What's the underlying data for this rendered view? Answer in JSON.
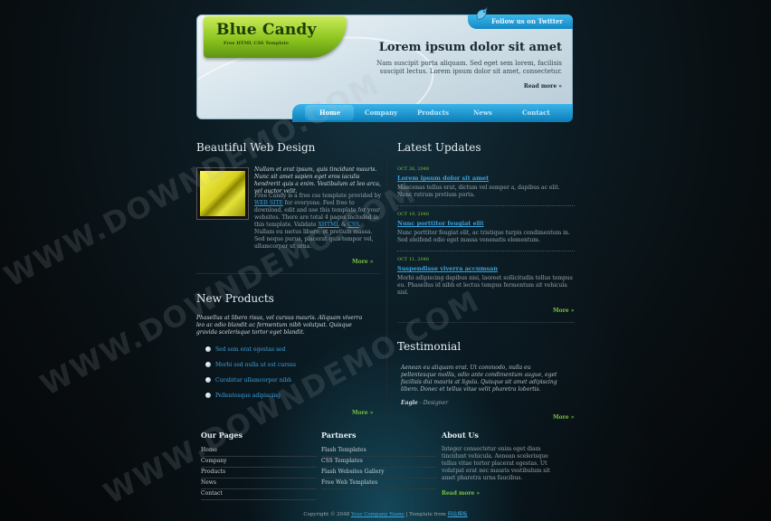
{
  "header": {
    "logo_title": "Blue Candy",
    "logo_subtitle": "Free HTML CSS Template",
    "twitter_label": "Follow us on Twitter",
    "hero_title": "Lorem ipsum dolor sit amet",
    "hero_text": "Nam suscipit porta aliquam. Sed eget sem lorem, facilisis suscipit lectus. Lorem ipsum dolor sit amet, consectetur.",
    "read_more": "Read more »"
  },
  "nav": {
    "items": [
      "Home",
      "Company",
      "Products",
      "News",
      "Contact"
    ],
    "active": "Home"
  },
  "left": {
    "title": "Beautiful Web Design",
    "intro_italic": "Nullam et erat ipsum, quis tincidunt mauris. Nunc sit amet sapien eget eros iaculis hendrerit quis a enim. Vestibulum at leo arcu, vel auctor velit.",
    "intro_text_a": "Free Candy is a free css template provided by ",
    "intro_link_a": "WEB SITE",
    "intro_text_b": " for everyone. Feel free to download, edit and use this template for your websites. There are total 4 pages included in this template. Validate ",
    "intro_link_b": "XHTML",
    "intro_text_c": " & ",
    "intro_link_c": "CSS",
    "intro_text_d": ". Nullam eu metus libero, et pretium massa. Sed neque purus, placerat quis tempor vel, ullamcorper ut urna.",
    "more1": "More »",
    "products_title": "New Products",
    "products_italic": "Phasellus at libero risus, vel cursus mauris. Aliquam viverra leo ac odio blandit ac fermentum nibh volutpat. Quisque gravida scelerisque tortor eget blandit.",
    "products": [
      "Sed sem erat egestas sed",
      "Morbi sed nulla ut est cursus",
      "Curabitur ullamcorper nibh",
      "Pellentesque adipiscing"
    ],
    "more2": "More »"
  },
  "right": {
    "updates_title": "Latest Updates",
    "updates": [
      {
        "date": "OCT 26, 2048",
        "title": "Lorem ipsum dolor sit amet",
        "text": "Maecenas tellus erat, dictum vel semper a, dapibus ac elit. Nunc rutrum pretium porta."
      },
      {
        "date": "OCT 19, 2048",
        "title": "Nunc porttitor feugiat elit",
        "text": "Nunc porttitor feugiat elit, ac tristique turpis condimentum in. Sed eleifend odio eget massa venenatis elementum."
      },
      {
        "date": "OCT 11, 2048",
        "title": "Suspendisse viverra accumsan",
        "text": "Morbi adipiscing dapibus nisi, laoreet sollicitudin tellus tempus eu. Phasellus id nibh et lectus tempus fermentum sit vehicula nisl."
      }
    ],
    "more3": "More »",
    "testimonial_title": "Testimonial",
    "testimonial_text": "Aenean eu aliquam erat. Ut commodo, nulla eu pellentesque mollis, odio ante condimentum augue, eget facilisis dui mauris at ligula. Quisque sit amet adipiscing libero. Donec et tellus vitae velit pharetra lobortis.",
    "testimonial_author": "Eagle",
    "testimonial_role": " - Designer",
    "more4": "More »"
  },
  "footer": {
    "pages_title": "Our Pages",
    "pages": [
      "Home",
      "Company",
      "Products",
      "News",
      "Contact"
    ],
    "partners_title": "Partners",
    "partners": [
      "Flash Templates",
      "CSS Templates",
      "Flash Websites Gallery",
      "Free Web Templates"
    ],
    "about_title": "About Us",
    "about_text": "Integer consectetur enim eget diam tincidunt vehicula. Aenean scelerisque tellus vitae tortor placerat egestas. Ut volutpat erat nec mauris vestibulum sit amet pharetra urna faucibus.",
    "read_more": "Read more »",
    "copyright_a": "Copyright © 2048 ",
    "copyright_link": "Your Company Name",
    "copyright_b": " | Template from ",
    "copyright_link2": "网站模板"
  },
  "watermark": "WWW.DOWNDEMO.COM"
}
